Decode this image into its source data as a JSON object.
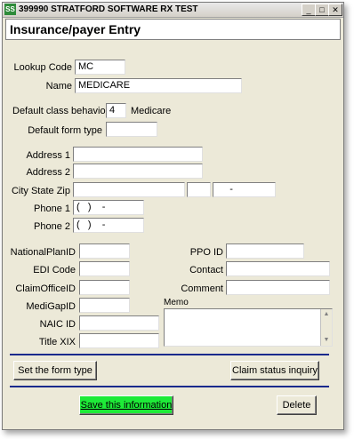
{
  "window": {
    "title": "399990 STRATFORD SOFTWARE RX TEST",
    "app_icon": "SS",
    "minimize_glyph": "_",
    "maximize_glyph": "□",
    "close_glyph": "✕"
  },
  "header": {
    "title": "Insurance/payer Entry"
  },
  "form": {
    "lookup_code": {
      "label": "Lookup Code",
      "value": "MC"
    },
    "name": {
      "label": "Name",
      "value": "MEDICARE"
    },
    "default_class_behavior": {
      "label": "Default class behavior",
      "value": "4",
      "description": "Medicare"
    },
    "default_form_type": {
      "label": "Default form type",
      "value": ""
    },
    "address1": {
      "label": "Address 1",
      "value": ""
    },
    "address2": {
      "label": "Address 2",
      "value": ""
    },
    "city_state_zip": {
      "label": "City State  Zip",
      "city": "",
      "state": "",
      "zip": "     -"
    },
    "phone1": {
      "label": "Phone 1",
      "value": "(   )    -"
    },
    "phone2": {
      "label": "Phone 2",
      "value": "(   )    -"
    },
    "national_plan_id": {
      "label": "NationalPlanID",
      "value": ""
    },
    "edi_code": {
      "label": "EDI Code",
      "value": ""
    },
    "claim_office_id": {
      "label": "ClaimOfficeID",
      "value": ""
    },
    "medigap_id": {
      "label": "MediGapID",
      "value": ""
    },
    "naic_id": {
      "label": "NAIC ID",
      "value": ""
    },
    "title_xix": {
      "label": "Title XIX",
      "value": ""
    },
    "ppo_id": {
      "label": "PPO ID",
      "value": ""
    },
    "contact": {
      "label": "Contact",
      "value": ""
    },
    "comment": {
      "label": "Comment",
      "value": ""
    },
    "memo": {
      "label": "Memo",
      "value": ""
    }
  },
  "buttons": {
    "set_form_type": "Set the form type",
    "claim_status": "Claim status inquiry",
    "save": "Save this information",
    "delete": "Delete"
  },
  "colors": {
    "save_button": "#1eea38",
    "divider": "#1a2a8c",
    "window_bg": "#ece9d8"
  }
}
